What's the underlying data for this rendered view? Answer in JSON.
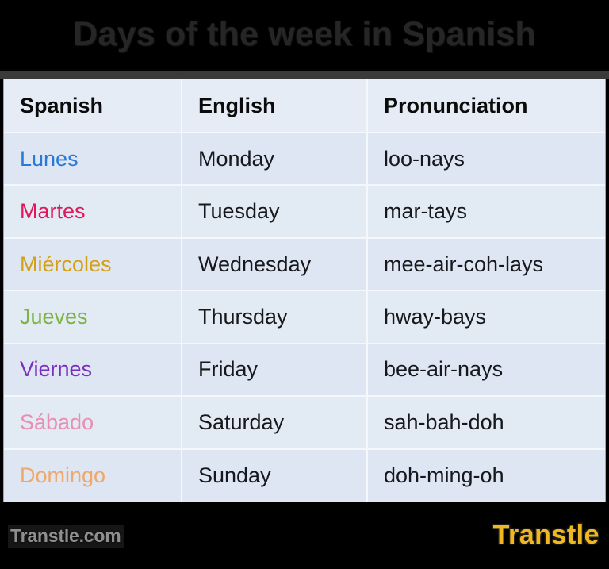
{
  "page": {
    "title": "Days of the week in Spanish",
    "background_color": "#000000",
    "title_color": "#262626"
  },
  "table": {
    "background_color": "#dee7f3",
    "header_background_color": "#e5ecf6",
    "headers": {
      "spanish": "Spanish",
      "english": "English",
      "pronunciation": "Pronunciation"
    },
    "rows": [
      {
        "spanish": "Lunes",
        "english": "Monday",
        "pronunciation": "loo-nays",
        "color": "#2979d8"
      },
      {
        "spanish": "Martes",
        "english": "Tuesday",
        "pronunciation": "mar-tays",
        "color": "#e0175b"
      },
      {
        "spanish": "Miércoles",
        "english": "Wednesday",
        "pronunciation": "mee-air-coh-lays",
        "color": "#d4a017"
      },
      {
        "spanish": "Jueves",
        "english": "Thursday",
        "pronunciation": "hway-bays",
        "color": "#7cb342"
      },
      {
        "spanish": "Viernes",
        "english": "Friday",
        "pronunciation": "bee-air-nays",
        "color": "#7b2fbe"
      },
      {
        "spanish": "Sábado",
        "english": "Saturday",
        "pronunciation": "sah-bah-doh",
        "color": "#ea8cb4"
      },
      {
        "spanish": "Domingo",
        "english": "Sunday",
        "pronunciation": "doh-ming-oh",
        "color": "#f0a868"
      }
    ]
  },
  "footer": {
    "watermark": "Transtle.com",
    "watermark_color": "#8f8f8f",
    "brand": "Transtle",
    "brand_color": "#f0b81e"
  }
}
